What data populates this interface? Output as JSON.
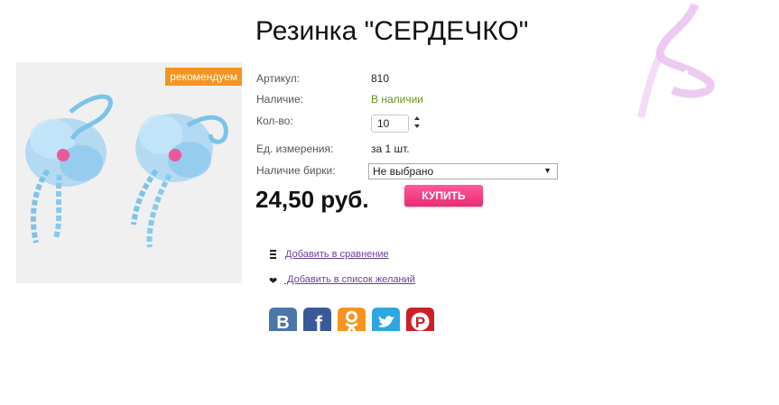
{
  "product": {
    "title": "Резинка \"СЕРДЕЧКО\"",
    "badge": "рекомендуем",
    "props": {
      "article_label": "Артикул:",
      "article_value": "810",
      "availability_label": "Наличие:",
      "availability_value": "В наличии",
      "quantity_label": "Кол-во:",
      "quantity_value": "10",
      "unit_label": "Ед. измерения:",
      "unit_value": "за 1 шт.",
      "tag_label": "Наличие бирки:",
      "tag_selected": "Не выбрано"
    },
    "price": "24,50 руб.",
    "buy_label": "КУПИТЬ"
  },
  "links": {
    "compare": "Добавить в сравнение",
    "wishlist": " Добавить в список желаний"
  },
  "social": [
    "vk-icon",
    "facebook-icon",
    "odnoklassniki-icon",
    "twitter-icon",
    "pinterest-icon"
  ],
  "colors": {
    "badge": "#f7931e",
    "buy_button": "#e82b72",
    "availability": "#6a8f1e",
    "link": "#6a3f9a",
    "vk": "#4a76a8",
    "facebook": "#3b5998",
    "odnoklassniki": "#f7931e",
    "twitter": "#2ca7e0",
    "pinterest": "#cb2027"
  }
}
